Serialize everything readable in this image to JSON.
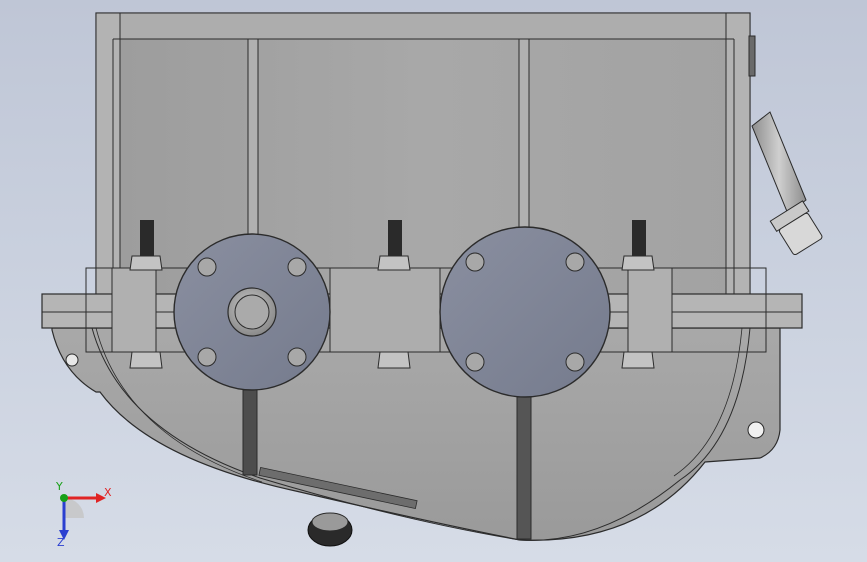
{
  "viewport": {
    "background_top": "#bfc6d6",
    "background_bottom": "#d6dce7"
  },
  "model": {
    "part": "gearbox-housing",
    "view": "front",
    "housing_color": "#a6a6a6",
    "flange_color": "#7c8294",
    "bolt_color": "#b9b9b9",
    "stud_color": "#2a2a2a",
    "outline_color": "#2b2b2b",
    "flanges": [
      {
        "name": "input-shaft-flange",
        "bolt_count": 4,
        "has_center_shaft": true
      },
      {
        "name": "output-shaft-flange",
        "bolt_count": 4,
        "has_center_shaft": false
      }
    ],
    "upper_bolts": 3,
    "lower_nuts": 3
  },
  "triad": {
    "x_label": "X",
    "y_label": "Y",
    "z_label": "Z",
    "x_color": "#e02424",
    "y_color": "#18a018",
    "z_color": "#2a3fd0"
  }
}
